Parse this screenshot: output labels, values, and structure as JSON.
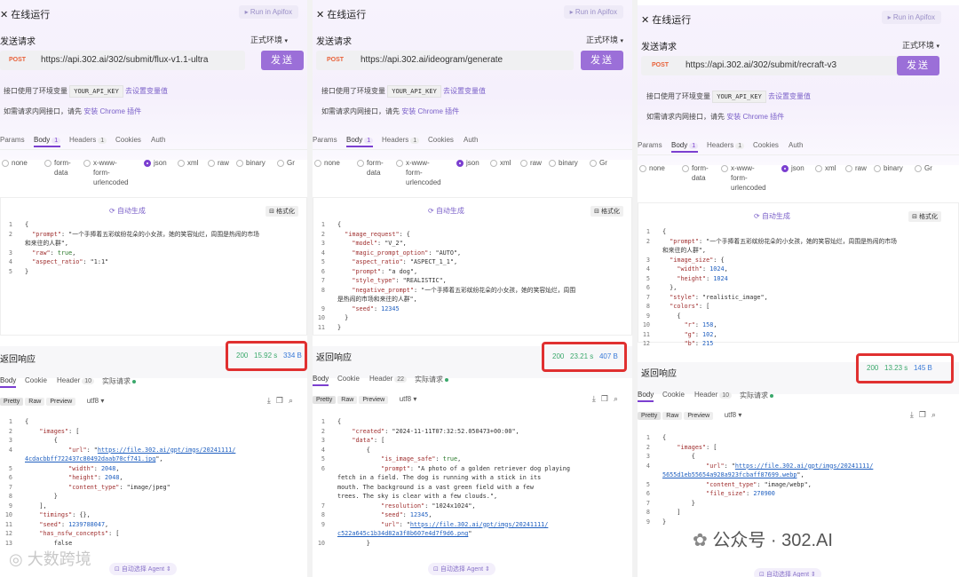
{
  "panels": [
    {
      "title": "在线运行",
      "run_label": "Run in Apifox",
      "send_request": "发送请求",
      "env": "正式环境",
      "method": "POST",
      "url": "https://api.302.ai/302/submit/flux-v1.1-ultra",
      "send_label": "发送",
      "env_var_prefix": "接口使用了环境变量",
      "env_var_chip": "YOUR_API_KEY",
      "env_var_link": "去设置变量值",
      "intranet_prefix": "如需请求内网接口，请先",
      "intranet_link": "安装 Chrome 插件",
      "tabs": [
        "Params",
        "Body",
        "Headers",
        "Cookies",
        "Auth"
      ],
      "body_badge": "1",
      "headers_badge": "1",
      "radios": [
        "none",
        "form-\ndata",
        "x-www-\nform-\nurlencoded",
        "json",
        "xml",
        "raw",
        "binary",
        "Gr"
      ],
      "auto_gen": "自动生成",
      "format_label": "格式化",
      "req_lines": [
        "{",
        "  \"prompt\": \"一个手捧着五彩缤纷花朵的小女孩，她的笑容灿烂，周围是热闹的市场",
        "和来往的人群\",",
        "  \"raw\": true,",
        "  \"aspect_ratio\": \"1:1\"",
        "}"
      ],
      "req_nums": [
        "1",
        "2",
        "",
        "3",
        "4",
        "5"
      ],
      "response_title": "返回响应",
      "status": "200",
      "time": "15.92 s",
      "size": "334 B",
      "resp_tabs": [
        "Body",
        "Cookie",
        "Header",
        "实际请求"
      ],
      "header_badge": "10",
      "view_modes": [
        "Pretty",
        "Raw",
        "Preview"
      ],
      "encoding": "utf8",
      "resp_lines": [
        "{",
        "    \"images\": [",
        "        {",
        "            \"url\": \"https://file.302.ai/gpt/imgs/20241111/",
        "4cdacbbff722437c80492daab70cf741.jpg\",",
        "            \"width\": 2048,",
        "            \"height\": 2048,",
        "            \"content_type\": \"image/jpeg\"",
        "        }",
        "    ],",
        "    \"timings\": {},",
        "    \"seed\": 1239788047,",
        "    \"has_nsfw_concepts\": [",
        "        false"
      ],
      "resp_nums": [
        "1",
        "2",
        "3",
        "4",
        "",
        "5",
        "6",
        "7",
        "8",
        "9",
        "10",
        "11",
        "12",
        "13"
      ],
      "agent_label": "自动选择 Agent"
    },
    {
      "title": "在线运行",
      "run_label": "Run in Apifox",
      "send_request": "发送请求",
      "env": "正式环境",
      "method": "POST",
      "url": "https://api.302.ai/ideogram/generate",
      "send_label": "发送",
      "env_var_prefix": "接口使用了环境变量",
      "env_var_chip": "YOUR_API_KEY",
      "env_var_link": "去设置变量值",
      "intranet_prefix": "如需请求内网接口，请先",
      "intranet_link": "安装 Chrome 插件",
      "tabs": [
        "Params",
        "Body",
        "Headers",
        "Cookies",
        "Auth"
      ],
      "body_badge": "1",
      "headers_badge": "1",
      "radios": [
        "none",
        "form-\ndata",
        "x-www-\nform-\nurlencoded",
        "json",
        "xml",
        "raw",
        "binary",
        "Gr"
      ],
      "auto_gen": "自动生成",
      "format_label": "格式化",
      "req_lines": [
        "{",
        "  \"image_request\": {",
        "    \"model\": \"V_2\",",
        "    \"magic_prompt_option\": \"AUTO\",",
        "    \"aspect_ratio\": \"ASPECT_1_1\",",
        "    \"prompt\": \"a dog\",",
        "    \"style_type\": \"REALISTIC\",",
        "    \"negative_prompt\": \"一个手捧着五彩缤纷花朵的小女孩，她的笑容灿烂，周围",
        "是热闹的市场和来往的人群\",",
        "    \"seed\": 12345",
        "  }",
        "}"
      ],
      "req_nums": [
        "1",
        "2",
        "3",
        "4",
        "5",
        "6",
        "7",
        "8",
        "",
        "9",
        "10",
        "11"
      ],
      "response_title": "返回响应",
      "status": "200",
      "time": "23.21 s",
      "size": "407 B",
      "resp_tabs": [
        "Body",
        "Cookie",
        "Header",
        "实际请求"
      ],
      "header_badge": "22",
      "view_modes": [
        "Pretty",
        "Raw",
        "Preview"
      ],
      "encoding": "utf8",
      "resp_lines": [
        "{",
        "    \"created\": \"2024-11-11T07:32:52.050473+00:00\",",
        "    \"data\": [",
        "        {",
        "            \"is_image_safe\": true,",
        "            \"prompt\": \"A photo of a golden retriever dog playing",
        "fetch in a field. The dog is running with a stick in its",
        "mouth. The background is a vast green field with a few",
        "trees. The sky is clear with a few clouds.\",",
        "            \"resolution\": \"1024x1024\",",
        "            \"seed\": 12345,",
        "            \"url\": \"https://file.302.ai/gpt/imgs/20241111/",
        "c522a645c1b34d82a3f8b607e4d7f9d6.png\"",
        "        }"
      ],
      "resp_nums": [
        "1",
        "2",
        "3",
        "4",
        "5",
        "6",
        "",
        "",
        "",
        "7",
        "8",
        "9",
        "",
        "10"
      ],
      "agent_label": "自动选择 Agent"
    },
    {
      "title": "在线运行",
      "run_label": "Run in Apifox",
      "send_request": "发送请求",
      "env": "正式环境",
      "method": "POST",
      "url": "https://api.302.ai/302/submit/recraft-v3",
      "send_label": "发送",
      "env_var_prefix": "接口使用了环境变量",
      "env_var_chip": "YOUR_API_KEY",
      "env_var_link": "去设置变量值",
      "intranet_prefix": "如需请求内网接口，请先",
      "intranet_link": "安装 Chrome 插件",
      "tabs": [
        "Params",
        "Body",
        "Headers",
        "Cookies",
        "Auth"
      ],
      "body_badge": "1",
      "headers_badge": "1",
      "radios": [
        "none",
        "form-\ndata",
        "x-www-\nform-\nurlencoded",
        "json",
        "xml",
        "raw",
        "binary",
        "Gr"
      ],
      "auto_gen": "自动生成",
      "format_label": "格式化",
      "req_lines": [
        "{",
        "  \"prompt\": \"一个手捧着五彩缤纷花朵的小女孩，她的笑容灿烂，周围是热闹的市场",
        "和来往的人群\",",
        "  \"image_size\": {",
        "    \"width\": 1024,",
        "    \"height\": 1024",
        "  },",
        "  \"style\": \"realistic_image\",",
        "  \"colors\": [",
        "    {",
        "      \"r\": 158,",
        "      \"g\": 102,",
        "      \"b\": 215"
      ],
      "req_nums": [
        "1",
        "2",
        "",
        "3",
        "4",
        "5",
        "6",
        "7",
        "8",
        "9",
        "10",
        "11",
        "12"
      ],
      "response_title": "返回响应",
      "status": "200",
      "time": "13.23 s",
      "size": "145 B",
      "resp_tabs": [
        "Body",
        "Cookie",
        "Header",
        "实际请求"
      ],
      "header_badge": "10",
      "view_modes": [
        "Pretty",
        "Raw",
        "Preview"
      ],
      "encoding": "utf8",
      "resp_lines": [
        "{",
        "    \"images\": [",
        "        {",
        "            \"url\": \"https://file.302.ai/gpt/imgs/20241111/",
        "5655d1eb55654a928a923fcbaff87699.webp\",",
        "            \"content_type\": \"image/webp\",",
        "            \"file_size\": 270900",
        "        }",
        "    ]",
        "}"
      ],
      "resp_nums": [
        "1",
        "2",
        "3",
        "4",
        "",
        "5",
        "6",
        "7",
        "8",
        "9"
      ],
      "agent_label": "自动选择 Agent"
    }
  ],
  "watermark_left": "大数跨境",
  "watermark_right_prefix": "公众号 ·",
  "watermark_right_suffix": "302.AI",
  "colors": {
    "accent": "#9b6fd8",
    "status_ok": "#3aa86b",
    "highlight": "#e03030",
    "post": "#e8623a"
  }
}
